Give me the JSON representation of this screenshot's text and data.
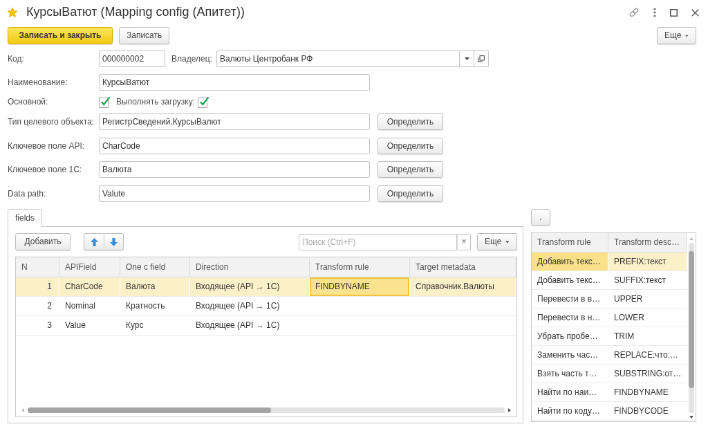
{
  "window": {
    "title": "КурсыВатют (Mapping config (Апитет))",
    "favorite": true
  },
  "command_bar": {
    "buttons": [
      {
        "label": "Записать и закрыть",
        "kind": "default_action"
      },
      {
        "label": "Записать",
        "kind": "plain"
      }
    ],
    "more": "Еще"
  },
  "form": {
    "code": {
      "label": "Код:",
      "value": "000000002"
    },
    "owner": {
      "label": "Владелец:",
      "value": "Валюты Центробанк РФ"
    },
    "name": {
      "label": "Наименование:",
      "value": "КурсыВатют"
    },
    "main": {
      "label": "Основной:",
      "checked": true
    },
    "load": {
      "label": "Выполнять загрузку:",
      "checked": true
    },
    "pick_rows": [
      {
        "label": "Тип целевого объекта:",
        "value": "РегистрСведений.КурсыВалют",
        "button": "Определить"
      },
      {
        "label": "Ключевое поле API:",
        "value": "CharCode",
        "button": "Определить"
      },
      {
        "label": "Ключевое поле 1С:",
        "value": "Валюта",
        "button": "Определить"
      },
      {
        "label": "Data path:",
        "value": "Valute",
        "button": "Определить"
      }
    ]
  },
  "tabs": [
    {
      "label": "fields",
      "selected": true
    }
  ],
  "fields_table": {
    "add_button": "Добавить",
    "search": {
      "placeholder": "Поиск (Ctrl+F)"
    },
    "clear_button": "×",
    "more": "Еще",
    "columns": [
      "N",
      "APIField",
      "One c field",
      "Direction",
      "Transform rule",
      "Target metadata"
    ],
    "rows": [
      {
        "selected": true,
        "cells": [
          {
            "text": "1",
            "focused": false
          },
          {
            "text": "CharCode",
            "focused": false
          },
          {
            "text": "Валюта",
            "focused": false
          },
          {
            "text": "Входящее (API → 1С)",
            "focused": false
          },
          {
            "text": "FINDBYNAME",
            "focused": true
          },
          {
            "text": "Справочник.Валюты",
            "focused": false
          }
        ]
      },
      {
        "selected": false,
        "cells": [
          {
            "text": "2",
            "focused": false
          },
          {
            "text": "Nominal",
            "focused": false
          },
          {
            "text": "Кратность",
            "focused": false
          },
          {
            "text": "Входящее (API → 1С)",
            "focused": false
          }
        ]
      },
      {
        "selected": false,
        "cells": [
          {
            "text": "3",
            "focused": false
          },
          {
            "text": "Value",
            "focused": false
          },
          {
            "text": "Курс",
            "focused": false
          },
          {
            "text": "Входящее (API → 1С)",
            "focused": false
          }
        ]
      }
    ]
  },
  "rules_panel": {
    "button": ".",
    "columns": [
      "Transform rule",
      "Transform desc…"
    ],
    "rows": [
      {
        "selected": true,
        "cells": [
          {
            "text": "Добавить текс…",
            "focused": true
          },
          {
            "text": "PREFIX:текст",
            "focused": false
          }
        ]
      },
      {
        "selected": false,
        "cells": [
          {
            "text": "Добавить текс…",
            "focused": false
          },
          {
            "text": "SUFFIX:текст",
            "focused": false
          }
        ]
      },
      {
        "selected": false,
        "cells": [
          {
            "text": "Перевести в в…",
            "focused": false
          },
          {
            "text": "UPPER",
            "focused": false
          }
        ]
      },
      {
        "selected": false,
        "cells": [
          {
            "text": "Перевести в н…",
            "focused": false
          },
          {
            "text": "LOWER",
            "focused": false
          }
        ]
      },
      {
        "selected": false,
        "cells": [
          {
            "text": "Убрать пробе…",
            "focused": false
          },
          {
            "text": "TRIM",
            "focused": false
          }
        ]
      },
      {
        "selected": false,
        "cells": [
          {
            "text": "Заменить час…",
            "focused": false
          },
          {
            "text": "REPLACE:что:…",
            "focused": false
          }
        ]
      },
      {
        "selected": false,
        "cells": [
          {
            "text": "Взять часть т…",
            "focused": false
          },
          {
            "text": "SUBSTRING:от…",
            "focused": false
          }
        ]
      },
      {
        "selected": false,
        "cells": [
          {
            "text": "Найти по наи…",
            "focused": false
          },
          {
            "text": "FINDBYNAME",
            "focused": false
          }
        ]
      },
      {
        "selected": false,
        "cells": [
          {
            "text": "Найти по коду…",
            "focused": false
          },
          {
            "text": "FINDBYCODE",
            "focused": false
          }
        ]
      }
    ]
  }
}
